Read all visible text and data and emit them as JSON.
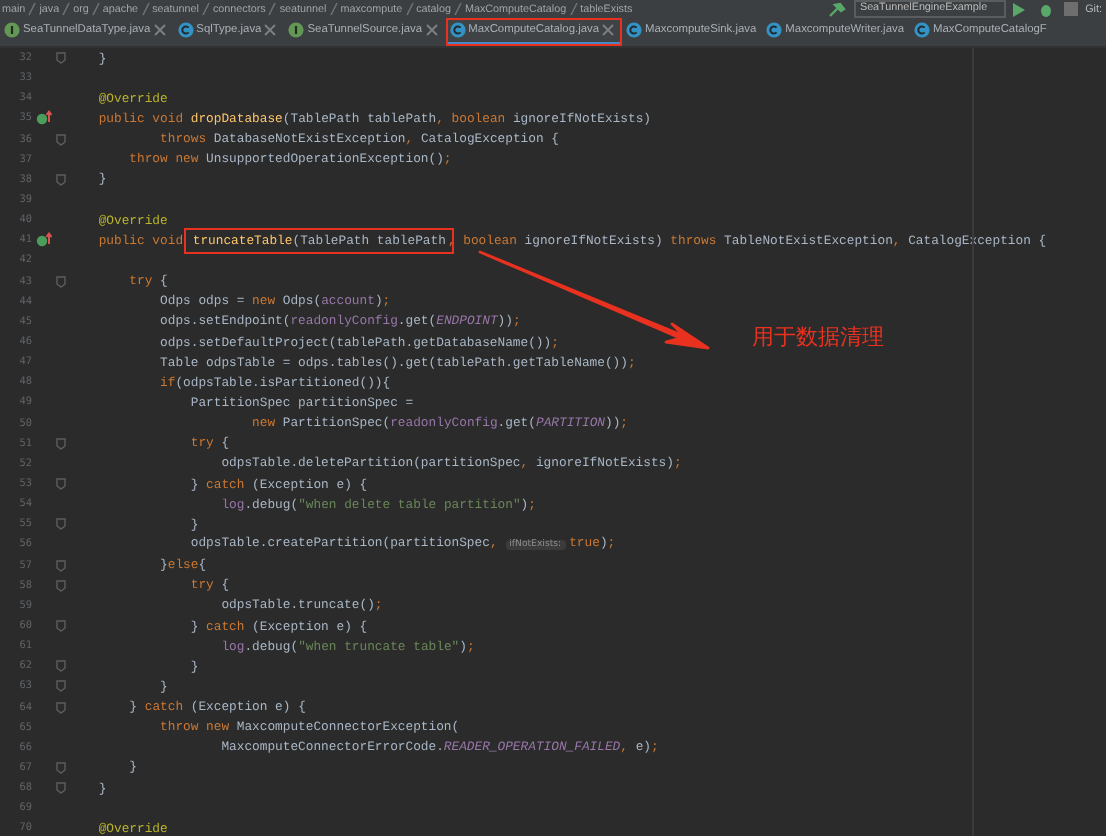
{
  "breadcrumbs": [
    "main",
    "java",
    "org",
    "apache",
    "seatunnel",
    "connectors",
    "seatunnel",
    "maxcompute",
    "catalog",
    "MaxComputeCatalog",
    "tableExists"
  ],
  "run_config": "SeaTunnelEngineExample",
  "git_label": "Git:",
  "tabs": [
    {
      "label": "SeaTunnelDataType.java",
      "kind": "interface",
      "selected": false,
      "closable": true,
      "annotated": false
    },
    {
      "label": "SqlType.java",
      "kind": "class",
      "selected": false,
      "closable": true,
      "annotated": false
    },
    {
      "label": "SeaTunnelSource.java",
      "kind": "interface",
      "selected": false,
      "closable": true,
      "annotated": false
    },
    {
      "label": "MaxComputeCatalog.java",
      "kind": "class",
      "selected": true,
      "closable": true,
      "annotated": true
    },
    {
      "label": "MaxcomputeSink.java",
      "kind": "class",
      "selected": false,
      "closable": false,
      "annotated": false
    },
    {
      "label": "MaxcomputeWriter.java",
      "kind": "class",
      "selected": false,
      "closable": false,
      "annotated": false
    },
    {
      "label": "MaxComputeCatalogF",
      "kind": "class",
      "selected": false,
      "closable": false,
      "annotated": false
    }
  ],
  "lines": [
    {
      "number": "32",
      "kind": "fold",
      "tokens": [
        {
          "kind": "plain",
          "text": "    }"
        }
      ]
    },
    {
      "number": "33"
    },
    {
      "number": "34",
      "tokens": [
        {
          "kind": "annotation",
          "text": "    @Override"
        }
      ]
    },
    {
      "number": "35",
      "kind": "override",
      "tokens": [
        {
          "kind": "keyword",
          "text": "    public void "
        },
        {
          "kind": "method",
          "text": "dropDatabase"
        },
        {
          "kind": "plain",
          "text": "(TablePath tablePath"
        },
        {
          "kind": "keyword",
          "text": ", boolean "
        },
        {
          "kind": "plain",
          "text": "ignoreIfNotExists)"
        }
      ]
    },
    {
      "number": "36",
      "kind": "fold",
      "tokens": [
        {
          "kind": "keyword",
          "text": "            throws "
        },
        {
          "kind": "plain",
          "text": "DatabaseNotExistException"
        },
        {
          "kind": "keyword",
          "text": ", "
        },
        {
          "kind": "plain",
          "text": "CatalogException {"
        }
      ]
    },
    {
      "number": "37",
      "tokens": [
        {
          "kind": "keyword",
          "text": "        throw new "
        },
        {
          "kind": "plain",
          "text": "UnsupportedOperationException()"
        },
        {
          "kind": "keyword",
          "text": ";"
        }
      ]
    },
    {
      "number": "38",
      "kind": "fold",
      "tokens": [
        {
          "kind": "plain",
          "text": "    }"
        }
      ]
    },
    {
      "number": "39"
    },
    {
      "number": "40",
      "tokens": [
        {
          "kind": "annotation",
          "text": "    @Override"
        }
      ]
    },
    {
      "number": "41",
      "kind": "override",
      "tokens": [
        {
          "kind": "keyword",
          "text": "    public void "
        },
        {
          "kind": "boxed",
          "tokens": [
            {
              "kind": "method",
              "text": "truncateTable"
            },
            {
              "kind": "plain",
              "text": "(TablePath tablePath"
            }
          ]
        },
        {
          "kind": "keyword",
          "text": ", boolean "
        },
        {
          "kind": "plain",
          "text": "ignoreIfNotExists) "
        },
        {
          "kind": "keyword",
          "text": "throws "
        },
        {
          "kind": "plain",
          "text": "TableNotExistException"
        },
        {
          "kind": "keyword",
          "text": ", "
        },
        {
          "kind": "plain",
          "text": "CatalogException {"
        }
      ]
    },
    {
      "number": "42"
    },
    {
      "number": "43",
      "kind": "fold",
      "tokens": [
        {
          "kind": "keyword",
          "text": "        try "
        },
        {
          "kind": "plain",
          "text": "{"
        }
      ]
    },
    {
      "number": "44",
      "tokens": [
        {
          "kind": "plain",
          "text": "            Odps odps = "
        },
        {
          "kind": "keyword",
          "text": "new "
        },
        {
          "kind": "plain",
          "text": "Odps("
        },
        {
          "kind": "field",
          "text": "account"
        },
        {
          "kind": "plain",
          "text": ")"
        },
        {
          "kind": "keyword",
          "text": ";"
        }
      ]
    },
    {
      "number": "45",
      "tokens": [
        {
          "kind": "plain",
          "text": "            odps.setEndpoint("
        },
        {
          "kind": "field",
          "text": "readonlyConfig"
        },
        {
          "kind": "plain",
          "text": ".get("
        },
        {
          "kind": "constant",
          "text": "ENDPOINT"
        },
        {
          "kind": "plain",
          "text": "))"
        },
        {
          "kind": "keyword",
          "text": ";"
        }
      ]
    },
    {
      "number": "46",
      "tokens": [
        {
          "kind": "plain",
          "text": "            odps.setDefaultProject(tablePath.getDatabaseName())"
        },
        {
          "kind": "keyword",
          "text": ";"
        }
      ]
    },
    {
      "number": "47",
      "tokens": [
        {
          "kind": "plain",
          "text": "            Table odpsTable = odps.tables().get(tablePath.getTableName())"
        },
        {
          "kind": "keyword",
          "text": ";"
        }
      ]
    },
    {
      "number": "48",
      "tokens": [
        {
          "kind": "keyword",
          "text": "            if"
        },
        {
          "kind": "plain",
          "text": "(odpsTable.isPartitioned()){"
        }
      ]
    },
    {
      "number": "49",
      "tokens": [
        {
          "kind": "plain",
          "text": "                PartitionSpec partitionSpec ="
        }
      ]
    },
    {
      "number": "50",
      "tokens": [
        {
          "kind": "keyword",
          "text": "                        new "
        },
        {
          "kind": "plain",
          "text": "PartitionSpec("
        },
        {
          "kind": "field",
          "text": "readonlyConfig"
        },
        {
          "kind": "plain",
          "text": ".get("
        },
        {
          "kind": "constant",
          "text": "PARTITION"
        },
        {
          "kind": "plain",
          "text": "))"
        },
        {
          "kind": "keyword",
          "text": ";"
        }
      ]
    },
    {
      "number": "51",
      "kind": "fold",
      "tokens": [
        {
          "kind": "keyword",
          "text": "                try "
        },
        {
          "kind": "plain",
          "text": "{"
        }
      ]
    },
    {
      "number": "52",
      "tokens": [
        {
          "kind": "plain",
          "text": "                    odpsTable.deletePartition(partitionSpec"
        },
        {
          "kind": "keyword",
          "text": ", "
        },
        {
          "kind": "plain",
          "text": "ignoreIfNotExists)"
        },
        {
          "kind": "keyword",
          "text": ";"
        }
      ]
    },
    {
      "number": "53",
      "kind": "fold",
      "tokens": [
        {
          "kind": "plain",
          "text": "                } "
        },
        {
          "kind": "keyword",
          "text": "catch "
        },
        {
          "kind": "plain",
          "text": "(Exception e) {"
        }
      ]
    },
    {
      "number": "54",
      "tokens": [
        {
          "kind": "field",
          "text": "                    log"
        },
        {
          "kind": "plain",
          "text": ".debug("
        },
        {
          "kind": "string",
          "text": "\"when delete table partition\""
        },
        {
          "kind": "plain",
          "text": ")"
        },
        {
          "kind": "keyword",
          "text": ";"
        }
      ]
    },
    {
      "number": "55",
      "kind": "fold",
      "tokens": [
        {
          "kind": "plain",
          "text": "                }"
        }
      ]
    },
    {
      "number": "56",
      "tokens": [
        {
          "kind": "plain",
          "text": "                odpsTable.createPartition(partitionSpec"
        },
        {
          "kind": "keyword",
          "text": ", "
        },
        {
          "kind": "hint",
          "text": "ifNotExists:"
        },
        {
          "kind": "keyword",
          "text": "true"
        },
        {
          "kind": "plain",
          "text": ")"
        },
        {
          "kind": "keyword",
          "text": ";"
        }
      ]
    },
    {
      "number": "57",
      "kind": "fold",
      "tokens": [
        {
          "kind": "plain",
          "text": "            }"
        },
        {
          "kind": "keyword",
          "text": "else"
        },
        {
          "kind": "plain",
          "text": "{"
        }
      ]
    },
    {
      "number": "58",
      "kind": "fold",
      "tokens": [
        {
          "kind": "keyword",
          "text": "                try "
        },
        {
          "kind": "plain",
          "text": "{"
        }
      ]
    },
    {
      "number": "59",
      "tokens": [
        {
          "kind": "plain",
          "text": "                    odpsTable.truncate()"
        },
        {
          "kind": "keyword",
          "text": ";"
        }
      ]
    },
    {
      "number": "60",
      "kind": "fold",
      "tokens": [
        {
          "kind": "plain",
          "text": "                } "
        },
        {
          "kind": "keyword",
          "text": "catch "
        },
        {
          "kind": "plain",
          "text": "(Exception e) {"
        }
      ]
    },
    {
      "number": "61",
      "tokens": [
        {
          "kind": "field",
          "text": "                    log"
        },
        {
          "kind": "plain",
          "text": ".debug("
        },
        {
          "kind": "string",
          "text": "\"when truncate table\""
        },
        {
          "kind": "plain",
          "text": ")"
        },
        {
          "kind": "keyword",
          "text": ";"
        }
      ]
    },
    {
      "number": "62",
      "kind": "fold",
      "tokens": [
        {
          "kind": "plain",
          "text": "                }"
        }
      ]
    },
    {
      "number": "63",
      "kind": "fold",
      "tokens": [
        {
          "kind": "plain",
          "text": "            }"
        }
      ]
    },
    {
      "number": "64",
      "kind": "fold",
      "tokens": [
        {
          "kind": "plain",
          "text": "        } "
        },
        {
          "kind": "keyword",
          "text": "catch "
        },
        {
          "kind": "plain",
          "text": "(Exception e) {"
        }
      ]
    },
    {
      "number": "65",
      "tokens": [
        {
          "kind": "keyword",
          "text": "            throw new "
        },
        {
          "kind": "plain",
          "text": "MaxcomputeConnectorException("
        }
      ]
    },
    {
      "number": "66",
      "tokens": [
        {
          "kind": "plain",
          "text": "                    MaxcomputeConnectorErrorCode."
        },
        {
          "kind": "constant",
          "text": "READER_OPERATION_FAILED"
        },
        {
          "kind": "keyword",
          "text": ", "
        },
        {
          "kind": "plain",
          "text": "e)"
        },
        {
          "kind": "keyword",
          "text": ";"
        }
      ]
    },
    {
      "number": "67",
      "kind": "fold",
      "tokens": [
        {
          "kind": "plain",
          "text": "        }"
        }
      ]
    },
    {
      "number": "68",
      "kind": "fold",
      "tokens": [
        {
          "kind": "plain",
          "text": "    }"
        }
      ]
    },
    {
      "number": "69"
    },
    {
      "number": "70",
      "tokens": [
        {
          "kind": "annotation",
          "text": "    @Override"
        }
      ]
    }
  ],
  "note": {
    "text": "用于数据清理"
  }
}
